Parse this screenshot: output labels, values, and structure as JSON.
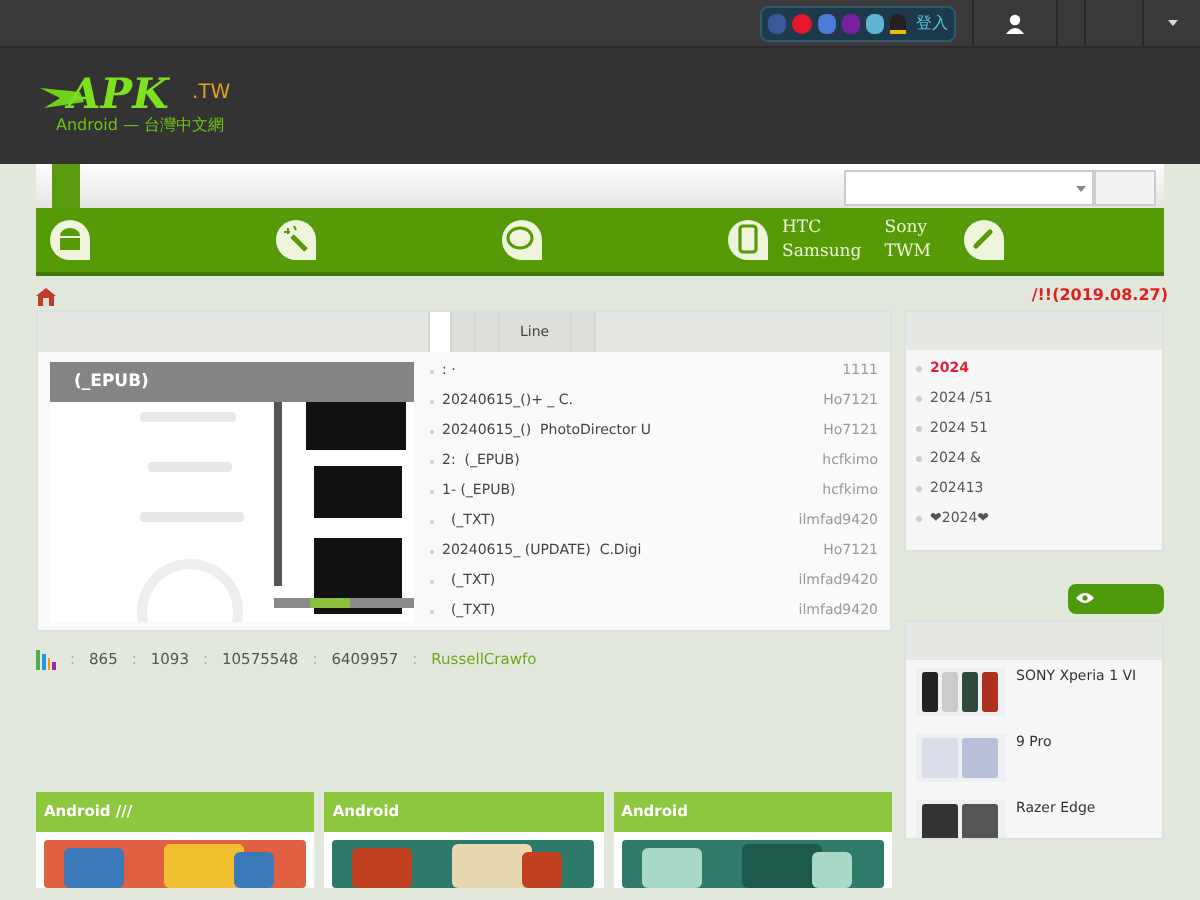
{
  "topbar": {
    "login": "登入"
  },
  "logo": {
    "name": "APK",
    "suffix": ".TW",
    "tagline": "Android — 台灣中文網"
  },
  "nav": {
    "links": [
      {
        "label": "HTC"
      },
      {
        "label": "Sony"
      },
      {
        "label": "Samsung"
      },
      {
        "label": "TWM"
      }
    ],
    "notice": "/!!(2019.08.27)"
  },
  "main": {
    "tabs": [
      {
        "selected": true
      },
      {
        "selected": false
      },
      {
        "selected": false
      },
      {
        "label": "Line",
        "selected": false
      },
      {
        "selected": false
      }
    ],
    "feature_caption": "(_EPUB)",
    "threads": [
      {
        "title": ": ·",
        "author": "1111"
      },
      {
        "title": "20240615_()+ _ C.",
        "author": "Ho7121"
      },
      {
        "title": "20240615_()  PhotoDirector U",
        "author": "Ho7121"
      },
      {
        "title": "2:  (_EPUB)",
        "author": "hcfkimo"
      },
      {
        "title": "1- (_EPUB)",
        "author": "hcfkimo"
      },
      {
        "title": "  (_TXT)",
        "author": "ilmfad9420"
      },
      {
        "title": "20240615_ (UPDATE)  C.Digi",
        "author": "Ho7121"
      },
      {
        "title": "  (_TXT)",
        "author": "ilmfad9420"
      },
      {
        "title": "  (_TXT)",
        "author": "ilmfad9420"
      }
    ]
  },
  "announcements": [
    {
      "text": "2024",
      "highlight": true
    },
    {
      "text": "2024 /51",
      "highlight": false
    },
    {
      "text": "2024 51",
      "highlight": false
    },
    {
      "text": "2024 &",
      "highlight": false
    },
    {
      "text": "202413",
      "highlight": false
    },
    {
      "text": "❤2024❤",
      "highlight": false
    }
  ],
  "stats": {
    "separator": ":",
    "values": [
      "865",
      "1093",
      "10575548",
      "6409957"
    ],
    "newest_member": "RussellCrawfo"
  },
  "devices": [
    {
      "name": "SONY Xperia 1 VI"
    },
    {
      "name": "9 Pro"
    },
    {
      "name": "Razer Edge"
    }
  ],
  "sections": [
    {
      "title": "Android ///"
    },
    {
      "title": "Android"
    },
    {
      "title": "Android"
    }
  ]
}
